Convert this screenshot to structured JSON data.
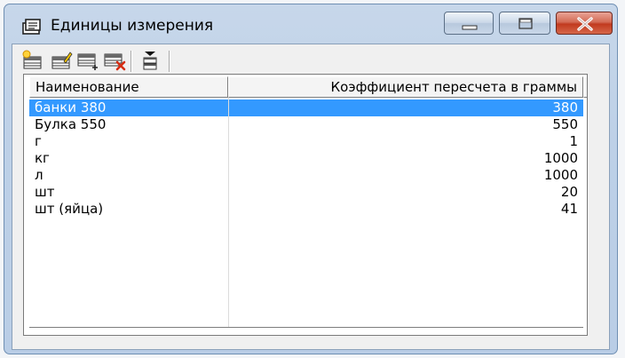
{
  "window": {
    "title": "Единицы измерения",
    "icon": "units-app-icon"
  },
  "title_buttons": [
    "minimize-icon",
    "maximize-icon",
    "close-icon"
  ],
  "toolbar": {
    "buttons": [
      "new-record-icon",
      "edit-record-icon",
      "add-row-icon",
      "delete-row-icon",
      "sort-icon"
    ]
  },
  "grid": {
    "columns": [
      "Наименование",
      "Коэффициент пересчета в граммы"
    ],
    "rows": [
      {
        "name": "банки 380",
        "coef": "380"
      },
      {
        "name": "Булка 550",
        "coef": "550"
      },
      {
        "name": "г",
        "coef": "1"
      },
      {
        "name": "кг",
        "coef": "1000"
      },
      {
        "name": "л",
        "coef": "1000"
      },
      {
        "name": "шт",
        "coef": "20"
      },
      {
        "name": "шт (яйца)",
        "coef": "41"
      }
    ],
    "selected_row": 0
  },
  "colors": {
    "selection": "#3399ff",
    "close_button": "#c13a1f",
    "frame": "#bdd0e7"
  }
}
